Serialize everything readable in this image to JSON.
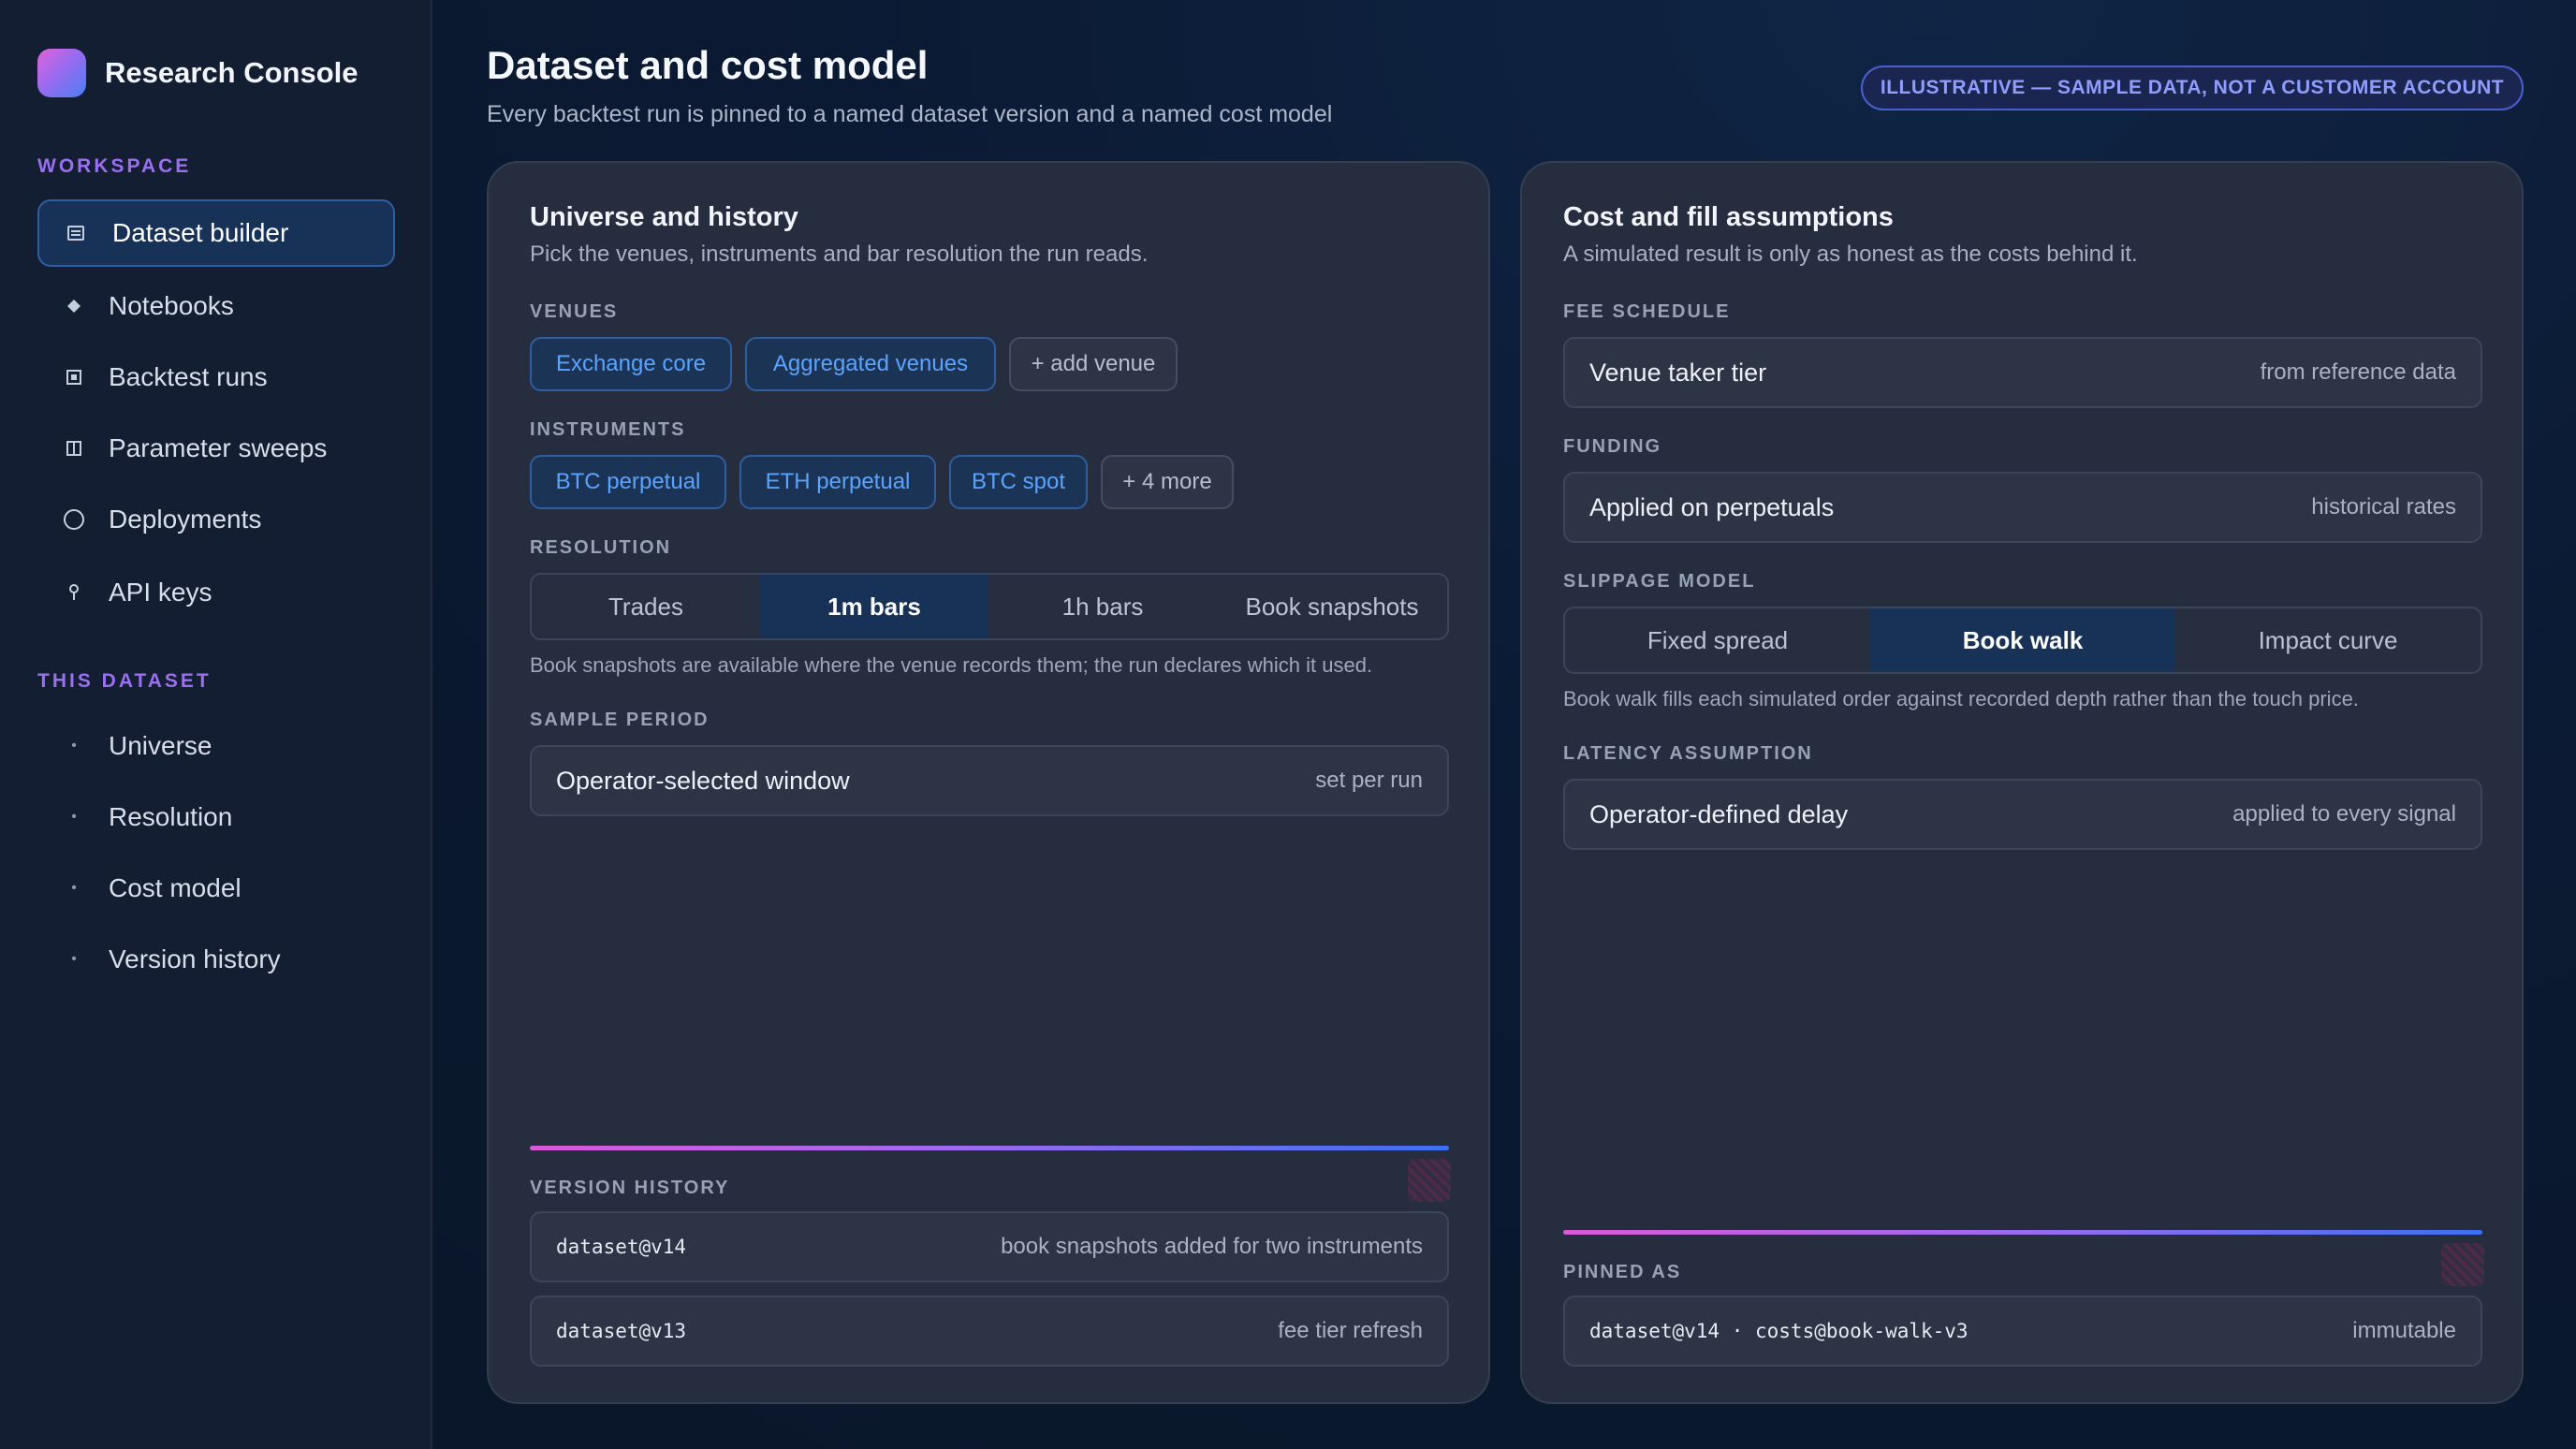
{
  "sidebar": {
    "brand": "Research Console",
    "workspace_label": "WORKSPACE",
    "items": [
      {
        "label": "Dataset builder",
        "icon": "dataset-icon"
      },
      {
        "label": "Notebooks",
        "icon": "notebook-icon"
      },
      {
        "label": "Backtest runs",
        "icon": "backtest-icon"
      },
      {
        "label": "Parameter sweeps",
        "icon": "sweep-icon"
      },
      {
        "label": "Deployments",
        "icon": "deploy-icon"
      },
      {
        "label": "API keys",
        "icon": "key-icon"
      }
    ],
    "dataset_label": "THIS DATASET",
    "dataset_items": [
      {
        "label": "Universe"
      },
      {
        "label": "Resolution"
      },
      {
        "label": "Cost model"
      },
      {
        "label": "Version history"
      }
    ]
  },
  "header": {
    "title": "Dataset and cost model",
    "subtitle": "Every backtest run is pinned to a named dataset version and a named cost model",
    "badge": "ILLUSTRATIVE — SAMPLE DATA, NOT A CUSTOMER ACCOUNT"
  },
  "universe": {
    "title": "Universe and history",
    "subtitle": "Pick the venues, instruments and bar resolution the run reads.",
    "venues_label": "VENUES",
    "venues": [
      "Exchange core",
      "Aggregated venues"
    ],
    "add_venue": "+ add venue",
    "instruments_label": "INSTRUMENTS",
    "instruments": [
      "BTC perpetual",
      "ETH perpetual",
      "BTC spot"
    ],
    "more_instruments": "+ 4 more",
    "resolution_label": "RESOLUTION",
    "resolution_options": [
      "Trades",
      "1m bars",
      "1h bars",
      "Book snapshots"
    ],
    "resolution_selected": "1m bars",
    "resolution_note": "Book snapshots are available where the venue records them; the run declares which it used.",
    "period_label": "SAMPLE PERIOD",
    "period_value": "Operator-selected window",
    "period_side": "set per run",
    "history_label": "VERSION HISTORY",
    "history": [
      {
        "version": "dataset@v14",
        "note": "book snapshots added for two instruments"
      },
      {
        "version": "dataset@v13",
        "note": "fee tier refresh"
      }
    ]
  },
  "costs": {
    "title": "Cost and fill assumptions",
    "subtitle": "A simulated result is only as honest as the costs behind it.",
    "fee_label": "FEE SCHEDULE",
    "fee_value": "Venue taker tier",
    "fee_side": "from reference data",
    "funding_label": "FUNDING",
    "funding_value": "Applied on perpetuals",
    "funding_side": "historical rates",
    "slippage_label": "SLIPPAGE MODEL",
    "slippage_options": [
      "Fixed spread",
      "Book walk",
      "Impact curve"
    ],
    "slippage_selected": "Book walk",
    "slippage_note": "Book walk fills each simulated order against recorded depth rather than the touch price.",
    "latency_label": "LATENCY ASSUMPTION",
    "latency_value": "Operator-defined delay",
    "latency_side": "applied to every signal",
    "pinned_label": "PINNED AS",
    "pinned_value": "dataset@v14 · costs@book-walk-v3",
    "pinned_side": "immutable"
  },
  "colors": {
    "accent": "#9a6ff0",
    "selected_fill": "#183156",
    "chip_text": "#5aa3ff"
  }
}
